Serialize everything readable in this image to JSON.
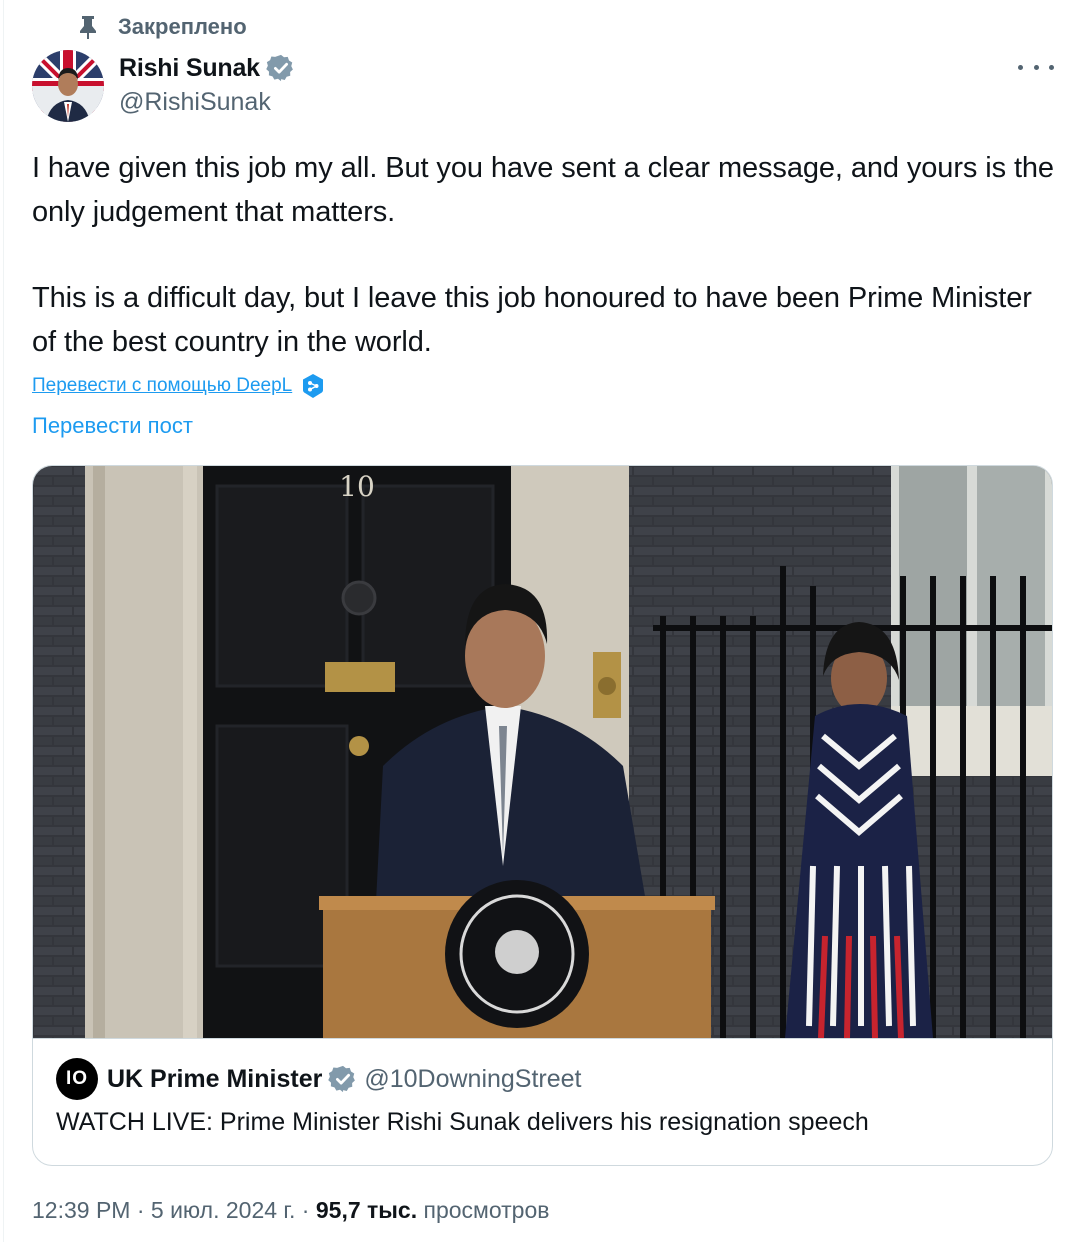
{
  "pinned": {
    "label": "Закреплено",
    "icon": "pin-icon"
  },
  "author": {
    "name": "Rishi Sunak",
    "handle": "@RishiSunak",
    "verified": true,
    "avatar": "avatar-photo",
    "verified_color": "#829aab"
  },
  "more_menu": {
    "icon": "more-horizontal-icon"
  },
  "tweet": {
    "paragraphs": [
      "I have given this job my all. But you have sent a clear message, and yours is the only judgement that matters.",
      "This is a difficult day, but I leave this job honoured to have been Prime Minister of the best country in the world."
    ]
  },
  "translate": {
    "deepl_label": "Перевести с помощью DeepL",
    "deepl_icon": "deepl-icon",
    "post_label": "Перевести пост",
    "link_color": "#1d9bf0"
  },
  "card": {
    "image": {
      "door_number": "10",
      "description_icon": "link-preview-image"
    },
    "source": {
      "avatar_text": "IO",
      "name": "UK Prime Minister",
      "handle": "@10DowningStreet",
      "verified": true
    },
    "title": "WATCH LIVE: Prime Minister Rishi Sunak delivers his resignation speech"
  },
  "meta": {
    "time": "12:39 PM",
    "sep1": " · ",
    "date": "5 июл. 2024 г.",
    "sep2": " · ",
    "views_count": "95,7 тыс.",
    "views_label": " просмотров"
  },
  "colors": {
    "text": "#0f1419",
    "secondary": "#536471",
    "border": "#cfd9de",
    "accent": "#1d9bf0"
  }
}
